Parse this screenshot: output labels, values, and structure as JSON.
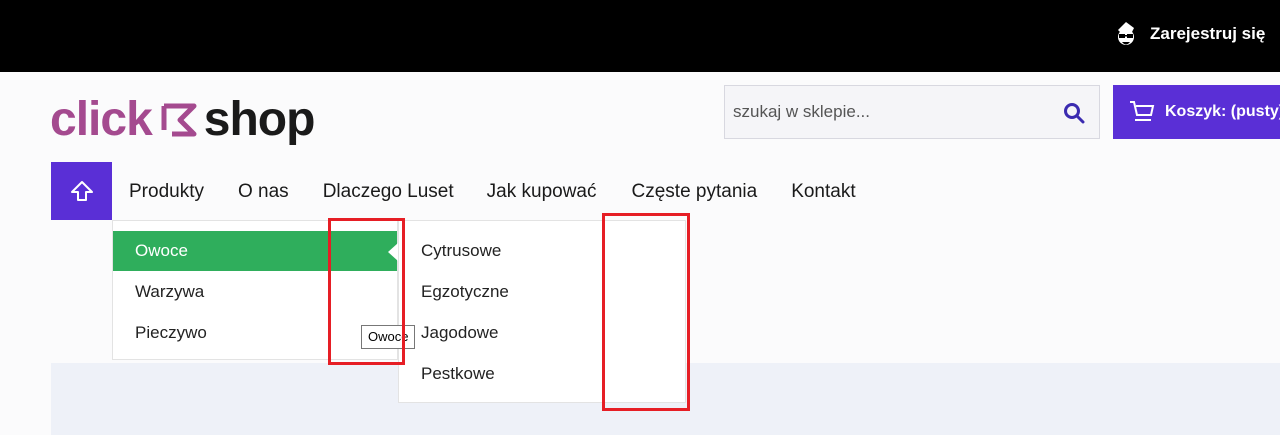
{
  "topbar": {
    "register_label": "Zarejestruj się"
  },
  "logo": {
    "part1": "click",
    "part2": "shop"
  },
  "search": {
    "placeholder": "szukaj w sklepie...",
    "value": ""
  },
  "cart": {
    "label": "Koszyk: (pusty)"
  },
  "nav": {
    "items": [
      "Produkty",
      "O nas",
      "Dlaczego Luset",
      "Jak kupować",
      "Częste pytania",
      "Kontakt"
    ]
  },
  "submenu": {
    "items": [
      "Owoce",
      "Warzywa",
      "Pieczywo"
    ],
    "active": "Owoce",
    "subitems": [
      "Cytrusowe",
      "Egzotyczne",
      "Jagodowe",
      "Pestkowe"
    ]
  },
  "tooltip": "Owoce",
  "colors": {
    "topbar": "#000000",
    "accent": "#5a2fd6",
    "active_item": "#2fae5c",
    "logo_click": "#a44a8f",
    "highlight_box": "#e61e25"
  }
}
